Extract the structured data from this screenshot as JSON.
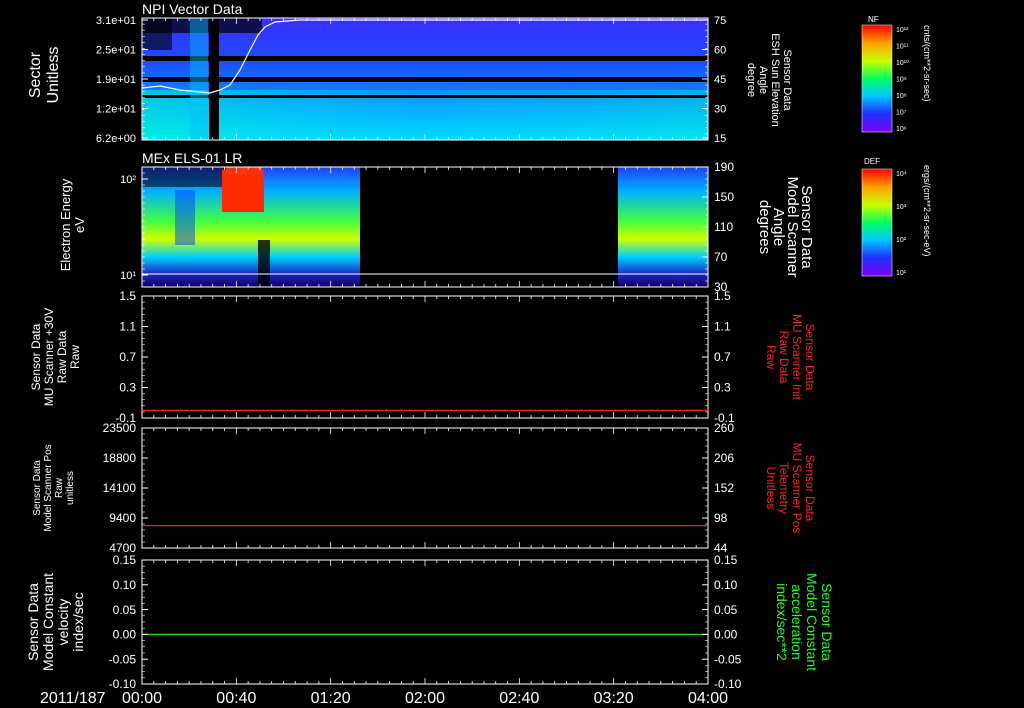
{
  "footer": {
    "date_label": "2011/187",
    "time_ticks": [
      "00:00",
      "00:40",
      "01:20",
      "02:00",
      "02:40",
      "03:20",
      "04:00"
    ]
  },
  "panel1": {
    "title": "NPI Vector Data",
    "left_label": [
      "Sector",
      "Unitless"
    ],
    "left_ticks": [
      "3.1e+01",
      "2.5e+01",
      "1.9e+01",
      "1.2e+01",
      "6.2e+00"
    ],
    "right_ticks": [
      "75",
      "60",
      "45",
      "30",
      "15"
    ],
    "right_label": [
      "Sensor Data",
      "ESH Sun Elevation",
      "Angle",
      "degree"
    ],
    "colorbar_title": "NF",
    "colorbar_ticks": [
      "10¹²",
      "10¹¹",
      "10¹⁰",
      "10⁹",
      "10⁸",
      "10⁷",
      "10⁶"
    ],
    "colorbar_unit": "cnts/(cm**2-sr-sec)"
  },
  "panel2": {
    "title": "MEx ELS-01 LR",
    "left_label": [
      "Electron Energy",
      "eV"
    ],
    "left_ticks": [
      "10²",
      "10¹"
    ],
    "right_ticks": [
      "190",
      "150",
      "110",
      "70",
      "30"
    ],
    "right_label": [
      "Sensor Data",
      "Model Scanner",
      "Angle",
      "degrees"
    ],
    "colorbar_title": "DEF",
    "colorbar_ticks": [
      "10⁴",
      "10³",
      "10²",
      "10¹"
    ],
    "colorbar_unit": "ergs/(cm**2-sr-sec-eV)"
  },
  "panel3": {
    "left_label": [
      "Sensor Data",
      "MU Scanner +30V",
      "Raw Data",
      "Raw"
    ],
    "left_ticks": [
      "1.5",
      "1.1",
      "0.7",
      "0.3",
      "-0.1"
    ],
    "right_ticks": [
      "1.5",
      "1.1",
      "0.7",
      "0.3",
      "-0.1"
    ],
    "right_label": [
      "Sensor Data",
      "MU Scanner Init",
      "Raw Data",
      "Raw"
    ],
    "line_value": 0.0
  },
  "panel4": {
    "left_label": [
      "Sensor Data",
      "Model Scanner Pos",
      "Raw",
      "unitless"
    ],
    "left_ticks": [
      "23500",
      "18800",
      "14100",
      "9400",
      "4700"
    ],
    "right_ticks": [
      "260",
      "206",
      "152",
      "98",
      "44"
    ],
    "right_label": [
      "Sensor Data",
      "MU Scanner Pos",
      "Telemetry",
      "Unitless"
    ],
    "line_value": 8200
  },
  "panel5": {
    "left_label": [
      "Sensor Data",
      "Model Constant",
      "velocity",
      "index/sec"
    ],
    "left_ticks": [
      "0.15",
      "0.10",
      "0.05",
      "0.00",
      "-0.05",
      "-0.10"
    ],
    "right_ticks": [
      "0.15",
      "0.10",
      "0.05",
      "0.00",
      "-0.05",
      "-0.10"
    ],
    "right_label": [
      "Sensor Data",
      "Model Constant",
      "acceleration",
      "index/sec**2"
    ],
    "line_value": 0.0
  },
  "colors": {
    "background": "#000000",
    "axes": "#ffffff",
    "red_trace": "#ff2020",
    "green_trace": "#20e020",
    "red_label": "#ff2020",
    "green_label": "#20ff20"
  }
}
